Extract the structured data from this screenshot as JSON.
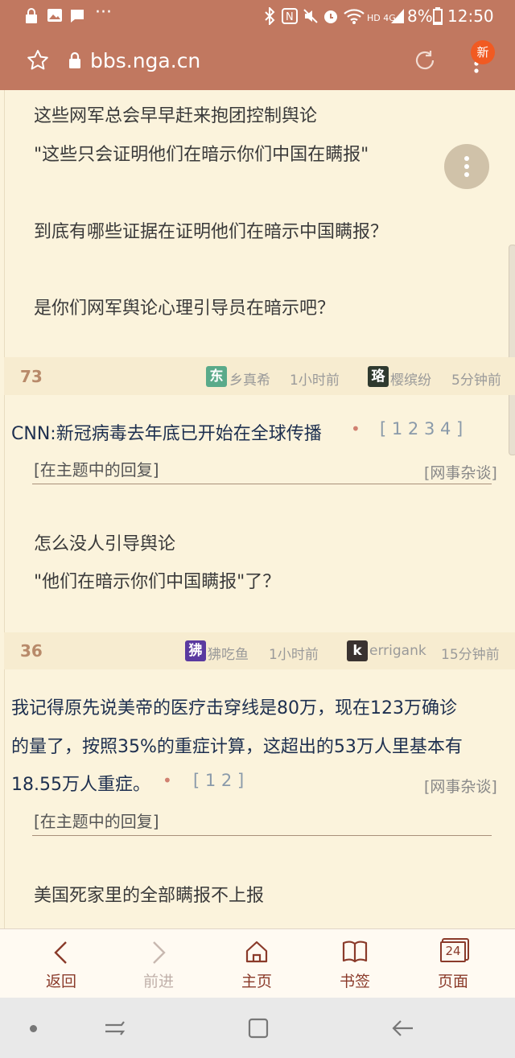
{
  "status_bar": {
    "battery": "8%",
    "time": "12:50",
    "network": "HD 4G"
  },
  "browser": {
    "url": "bbs.nga.cn",
    "new_badge": "新"
  },
  "posts": [
    {
      "lines": [
        "这些网军总会早早赶来抱团控制舆论",
        "\"这些只会证明他们在暗示你们中国在瞒报\"",
        "到底有哪些证据在证明他们在暗示中国瞒报？",
        "是你们网军舆论心理引导员在暗示吧？"
      ]
    }
  ],
  "threads": [
    {
      "floor": "73",
      "author_avatar": "东",
      "author": "乡真希",
      "author_time": "1小时前",
      "last_avatar": "珞",
      "last_author": "樱缤纷",
      "last_time": "5分钟前",
      "title": "CNN:新冠病毒去年底已开始在全球传播",
      "pages": "[ 1 2 3 4 ]",
      "category": "[网事杂谈]",
      "reply_tag": "[在主题中的回复]",
      "reply_lines": [
        "怎么没人引导舆论",
        "\"他们在暗示你们中国瞒报\"了？"
      ]
    },
    {
      "floor": "36",
      "author_avatar": "狒",
      "author": "狒吃鱼",
      "author_time": "1小时前",
      "last_avatar": "k",
      "last_author": "errigank",
      "last_time": "15分钟前",
      "title_lines": [
        "我记得原先说美帝的医疗击穿线是80万，现在123万确诊",
        "的量了，按照35%的重症计算，这超出的53万人里基本有",
        "18.55万人重症。"
      ],
      "pages": "[ 1 2 ]",
      "category": "[网事杂谈]",
      "reply_tag": "[在主题中的回复]",
      "reply_lines": [
        "美国死家里的全部瞒报不上报"
      ]
    }
  ],
  "bottom_nav": {
    "back": "返回",
    "forward": "前进",
    "home": "主页",
    "bookmarks": "书签",
    "pages": "页面",
    "page_count": "24"
  },
  "colors": {
    "accent": "#c17860",
    "bg": "#fbf3dc",
    "title": "#1d2f4f"
  }
}
